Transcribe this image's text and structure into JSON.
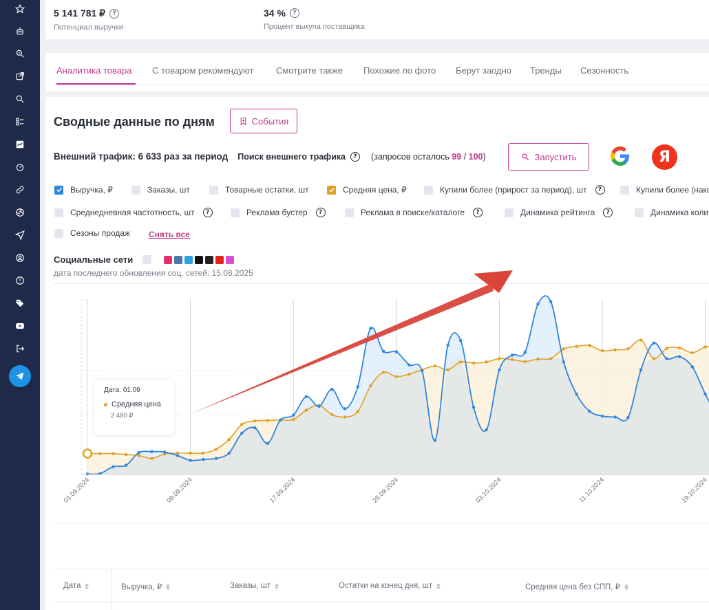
{
  "stats": [
    {
      "value": "5 141 781 ₽",
      "label": "Потенциал выручки"
    },
    {
      "value": "34 %",
      "label": "Процент выкупа поставщика"
    }
  ],
  "tabs": [
    "Аналитика товара",
    "С товаром рекомендуют",
    "Смотрите также",
    "Похожие по фото",
    "Берут заодно",
    "Тренды",
    "Сезонность"
  ],
  "main": {
    "title": "Сводные данные по дням",
    "events_button": "События",
    "traffic_label": "Внешний трафик: 6 633 раз за период",
    "traffic_search": "Поиск внешнего трафика",
    "requests_prefix": "(запросов осталось ",
    "requests_left": "99",
    "requests_sep": " / ",
    "requests_total": "100",
    "requests_suffix": ")",
    "run_button": "Запустить",
    "yandex_letter": "Я",
    "reset_link": "Снять все",
    "social_title": "Социальные сети",
    "social_date": "дата последнего обновления соц. сетей: 15.08.2025"
  },
  "checkboxes": [
    {
      "label": "Выручка, ₽",
      "checked": true,
      "color": "#2e86de"
    },
    {
      "label": "Заказы, шт",
      "checked": false
    },
    {
      "label": "Товарные остатки, шт",
      "checked": false
    },
    {
      "label": "Средняя цена, ₽",
      "checked": true,
      "color": "#e09f25"
    },
    {
      "label": "Купили более (прирост за период), шт",
      "checked": false,
      "help": true
    },
    {
      "label": "Купили более (нако",
      "checked": false
    },
    {
      "label": "Среднедневная частотность, шт",
      "checked": false,
      "help": true
    },
    {
      "label": "Реклама бустер",
      "checked": false,
      "help": true
    },
    {
      "label": "Реклама в поиске/каталоге",
      "checked": false,
      "help": true
    },
    {
      "label": "Динамика рейтинга",
      "checked": false,
      "help": true
    },
    {
      "label": "Динамика колич",
      "checked": false
    },
    {
      "label": "Сезоны продаж",
      "checked": false
    }
  ],
  "social_icons": [
    "instagram-icon",
    "vk-icon",
    "telegram-icon",
    "tiktok-icon",
    "dzen-icon",
    "youtube-icon",
    "vk-clips-icon"
  ],
  "tooltip": {
    "date": "Дата: 01.09",
    "series": "Средняя цена",
    "value": "2 480 ₽"
  },
  "chart_data": {
    "type": "line",
    "x_ticks": [
      "01.09.2024",
      "09.09.2024",
      "17.09.2024",
      "25.09.2024",
      "03.10.2024",
      "11.10.2024",
      "19.10.2024"
    ],
    "x_dates": [
      "01.09",
      "02.09",
      "03.09",
      "04.09",
      "05.09",
      "06.09",
      "07.09",
      "08.09",
      "09.09",
      "10.09",
      "11.09",
      "12.09",
      "13.09",
      "14.09",
      "15.09",
      "16.09",
      "17.09",
      "18.09",
      "19.09",
      "20.09",
      "21.09",
      "22.09",
      "23.09",
      "24.09",
      "25.09",
      "26.09",
      "27.09",
      "28.09",
      "29.09",
      "30.09",
      "01.10",
      "02.10",
      "03.10",
      "04.10",
      "05.10",
      "06.10",
      "07.10",
      "08.10",
      "09.10",
      "10.10",
      "11.10",
      "12.10",
      "13.10",
      "14.10",
      "15.10",
      "16.10",
      "17.10",
      "18.10",
      "19.10",
      "20.10"
    ],
    "series": [
      {
        "name": "Выручка, ₽",
        "color": "#2e86de",
        "fill": "#e4f0fb",
        "values": [
          1,
          2,
          16,
          19,
          45,
          47,
          46,
          39,
          29,
          31,
          33,
          44,
          85,
          96,
          64,
          112,
          122,
          160,
          140,
          175,
          135,
          180,
          300,
          253,
          252,
          225,
          213,
          70,
          265,
          275,
          138,
          92,
          215,
          245,
          251,
          350,
          355,
          231,
          165,
          130,
          120,
          118,
          117,
          215,
          270,
          238,
          242,
          221,
          165,
          115
        ]
      },
      {
        "name": "Средняя цена, ₽",
        "color": "#e09f25",
        "fill": "#fbf1dd",
        "values": [
          43,
          43,
          43,
          41,
          39,
          33,
          42,
          44,
          44,
          44,
          52,
          72,
          103,
          110,
          111,
          112,
          113,
          132,
          142,
          123,
          118,
          129,
          182,
          210,
          201,
          206,
          215,
          223,
          215,
          231,
          229,
          231,
          238,
          236,
          232,
          237,
          238,
          258,
          263,
          265,
          254,
          256,
          258,
          276,
          238,
          259,
          260,
          250,
          262,
          265
        ]
      }
    ],
    "area_fill": "#e4e8e6",
    "ylim": [
      0,
      360
    ]
  },
  "table": {
    "headers": [
      "Дата",
      "Выручка, ₽",
      "Заказы, шт",
      "Остатки на конец дня, шт",
      "Средняя цена без СПП, ₽"
    ]
  }
}
